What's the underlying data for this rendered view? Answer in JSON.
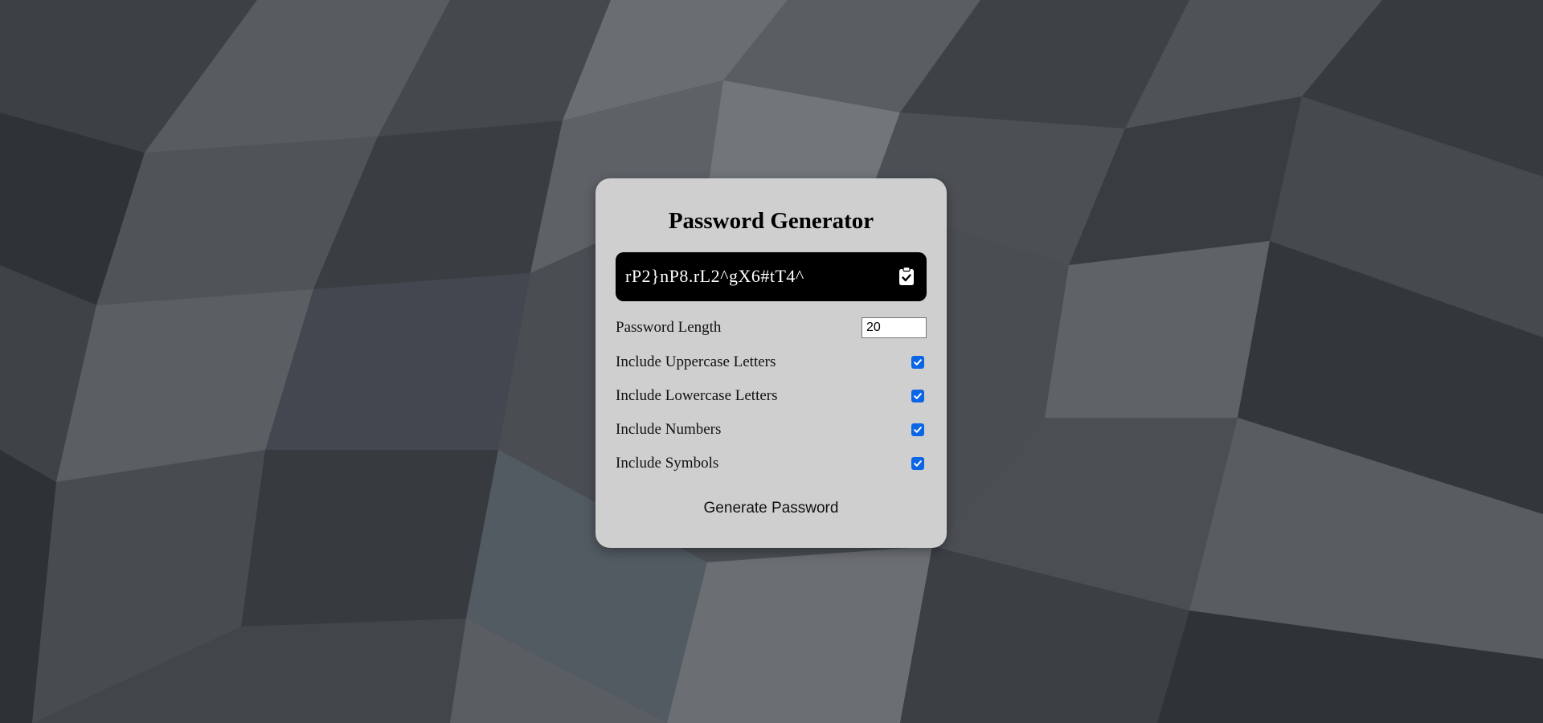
{
  "app": {
    "title": "Password Generator"
  },
  "result": {
    "password": "rP2}nP8.rL2^gX6#tT4^",
    "copy_icon": "clipboard-check-icon"
  },
  "settings": {
    "length_label": "Password Length",
    "length_value": "20",
    "options": [
      {
        "label": "Include Uppercase Letters",
        "checked": true
      },
      {
        "label": "Include Lowercase Letters",
        "checked": true
      },
      {
        "label": "Include Numbers",
        "checked": true
      },
      {
        "label": "Include Symbols",
        "checked": true
      }
    ]
  },
  "actions": {
    "generate_label": "Generate Password"
  },
  "colors": {
    "card_bg": "#cfcfcf",
    "result_bg": "#000000",
    "checkbox_accent": "#0a66e6",
    "background": "#4d5155"
  }
}
